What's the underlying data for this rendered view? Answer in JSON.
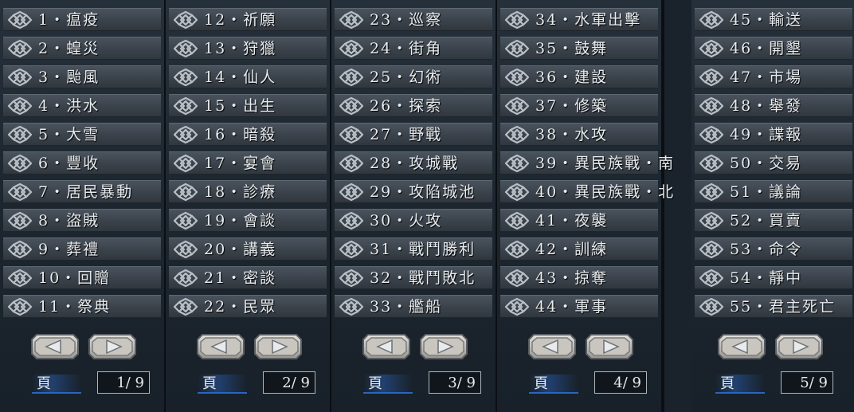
{
  "page_label": "頁",
  "panels": [
    {
      "items": [
        "1・瘟疫",
        "2・蝗災",
        "3・颱風",
        "4・洪水",
        "5・大雪",
        "6・豐收",
        "7・居民暴動",
        "8・盜賊",
        "9・葬禮",
        "10・回贈",
        "11・祭典"
      ],
      "page": "1/ 9"
    },
    {
      "items": [
        "12・祈願",
        "13・狩獵",
        "14・仙人",
        "15・出生",
        "16・暗殺",
        "17・宴會",
        "18・診療",
        "19・會談",
        "20・講義",
        "21・密談",
        "22・民眾"
      ],
      "page": "2/ 9"
    },
    {
      "items": [
        "23・巡察",
        "24・街角",
        "25・幻術",
        "26・探索",
        "27・野戰",
        "28・攻城戰",
        "29・攻陷城池",
        "30・火攻",
        "31・戰鬥勝利",
        "32・戰鬥敗北",
        "33・艦船"
      ],
      "page": "3/ 9"
    },
    {
      "items": [
        "34・水軍出擊",
        "35・鼓舞",
        "36・建設",
        "37・修築",
        "38・水攻",
        "39・異民族戰・南",
        "40・異民族戰・北",
        "41・夜襲",
        "42・訓練",
        "43・掠奪",
        "44・軍事"
      ],
      "page": "4/ 9"
    },
    {
      "items": [
        "45・輸送",
        "46・開墾",
        "47・市場",
        "48・舉發",
        "49・諜報",
        "50・交易",
        "51・議論",
        "52・買賣",
        "53・命令",
        "54・靜中",
        "55・君主死亡"
      ],
      "page": "5/ 9"
    }
  ]
}
